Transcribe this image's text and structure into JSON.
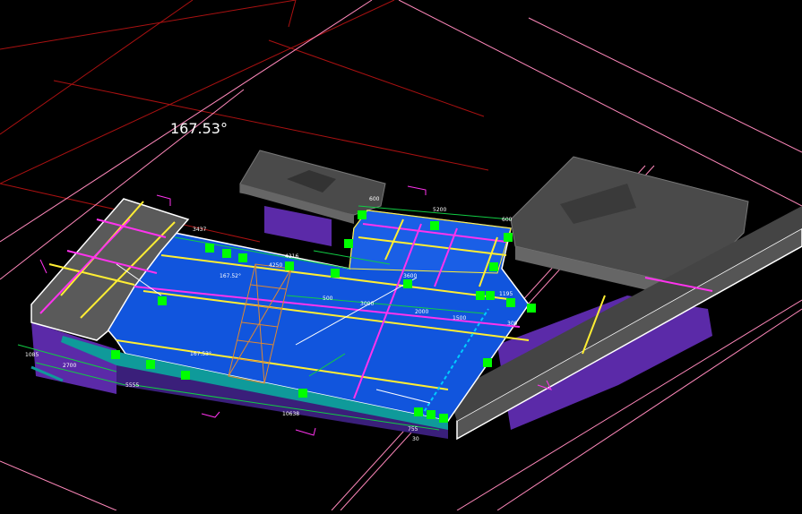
{
  "viewport": {
    "angle_readout": "167.53°",
    "colors": {
      "background": "#000000",
      "slab_blue": "#1155dd",
      "massing_gray": "#555555",
      "massing_purple": "#5b2aa8",
      "grip_green": "#00ff00",
      "axis_yellow": "#ffee33",
      "axis_magenta": "#ff33ee",
      "dimension_green": "#11cc44",
      "site_red": "#aa1111",
      "site_pink": "#ff88bb"
    },
    "dimensions": {
      "top_left": "600",
      "top_mid": "5200",
      "top_right": "600",
      "ramp_a": "3437",
      "ramp_b": "167.52°",
      "mid_1": "4216",
      "mid_2": "4250",
      "mid_3": "3600",
      "mid_4": "3000",
      "mid_5": "500",
      "mid_6": "1500",
      "mid_7": "2000",
      "right_1": "1195",
      "right_2": "300",
      "left_1": "2700",
      "left_2": "5555",
      "left_3": "1085",
      "left_4": "167.53°",
      "bottom": "10638",
      "bottom_r": "755",
      "bottom_r2": "30"
    }
  }
}
